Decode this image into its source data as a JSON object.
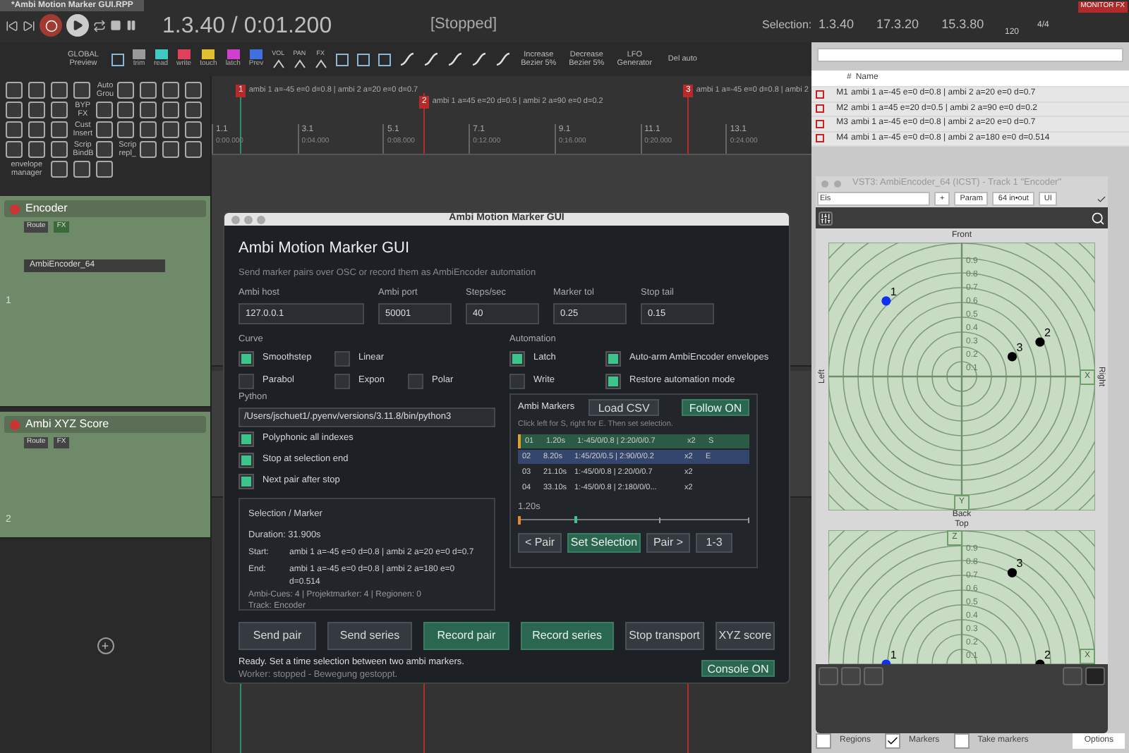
{
  "project_tab": "*Ambi Motion Marker GUI.RPP",
  "transport": {
    "position": "1.3.40 / 0:01.200",
    "state": "[Stopped]"
  },
  "selection": {
    "label": "Selection:",
    "start": "1.3.40",
    "end": "17.3.20",
    "length": "15.3.80"
  },
  "tempo": "120",
  "time_signature": "4/4",
  "monitor_fx": "MONITOR FX",
  "toolbar": [
    {
      "kind": "text",
      "label": "GLOBAL Preview"
    },
    {
      "kind": "icon"
    },
    {
      "kind": "mode",
      "label": "trim",
      "color": "#9a9a9a"
    },
    {
      "kind": "mode",
      "label": "read",
      "color": "#3fc9c0"
    },
    {
      "kind": "mode",
      "label": "write",
      "color": "#e0405a"
    },
    {
      "kind": "mode",
      "label": "touch",
      "color": "#e0c030"
    },
    {
      "kind": "mode",
      "label": "latch",
      "color": "#d040d0"
    },
    {
      "kind": "mode",
      "label": "Prev",
      "color": "#4070e0"
    },
    {
      "kind": "env",
      "label": "VOL"
    },
    {
      "kind": "env",
      "label": "PAN"
    },
    {
      "kind": "env",
      "label": "FX"
    },
    {
      "kind": "icon"
    },
    {
      "kind": "icon"
    },
    {
      "kind": "icon"
    },
    {
      "kind": "curve"
    },
    {
      "kind": "curve"
    },
    {
      "kind": "curve"
    },
    {
      "kind": "curve"
    },
    {
      "kind": "curve"
    },
    {
      "kind": "text",
      "label": "Increase Bezier 5%"
    },
    {
      "kind": "text",
      "label": "Decrease Bezier 5%"
    },
    {
      "kind": "text",
      "label": "LFO Generator"
    },
    {
      "kind": "text",
      "label": "Del auto"
    }
  ],
  "tool_grid": [
    {
      "kind": "icon"
    },
    {
      "kind": "icon"
    },
    {
      "kind": "icon"
    },
    {
      "kind": "icon"
    },
    {
      "kind": "text",
      "label": "Auto Grou"
    },
    {
      "kind": "icon"
    },
    {
      "kind": "icon"
    },
    {
      "kind": "icon"
    },
    {
      "kind": "icon"
    },
    {
      "kind": "icon"
    },
    {
      "kind": "icon"
    },
    {
      "kind": "icon"
    },
    {
      "kind": "text",
      "label": "BYP FX"
    },
    {
      "kind": "icon"
    },
    {
      "kind": "icon"
    },
    {
      "kind": "icon"
    },
    {
      "kind": "icon"
    },
    {
      "kind": "icon"
    },
    {
      "kind": "icon"
    },
    {
      "kind": "icon"
    },
    {
      "kind": "icon"
    },
    {
      "kind": "text",
      "label": "Cust Insert"
    },
    {
      "kind": "icon"
    },
    {
      "kind": "icon"
    },
    {
      "kind": "icon"
    },
    {
      "kind": "icon"
    },
    {
      "kind": "icon"
    },
    {
      "kind": "icon"
    },
    {
      "kind": "icon"
    },
    {
      "kind": "icon"
    },
    {
      "kind": "text",
      "label": "Scrip BindB"
    },
    {
      "kind": "icon"
    },
    {
      "kind": "text",
      "label": "Scrip repl_"
    },
    {
      "kind": "icon"
    },
    {
      "kind": "icon"
    },
    {
      "kind": "icon"
    },
    {
      "kind": "text",
      "label": "envelope manager"
    },
    {
      "kind": "icon"
    },
    {
      "kind": "icon"
    },
    {
      "kind": "icon"
    }
  ],
  "timeline_markers": [
    {
      "number": "1",
      "label": "ambi 1 a=-45 e=0 d=0.8 | ambi 2 a=20 e=0 d=0.7"
    },
    {
      "number": "2",
      "label": "ambi 1 a=45 e=20 d=0.5 | ambi 2 a=90 e=0 d=0.2"
    },
    {
      "number": "3",
      "label": "ambi 1 a=-45 e=0 d=0.8 | ambi 2"
    }
  ],
  "ruler": [
    {
      "bar": "1.1",
      "time": "0:00.000"
    },
    {
      "bar": "3.1",
      "time": "0:04.000"
    },
    {
      "bar": "5.1",
      "time": "0:08.000"
    },
    {
      "bar": "7.1",
      "time": "0:12.000"
    },
    {
      "bar": "9.1",
      "time": "0:16.000"
    },
    {
      "bar": "11.1",
      "time": "0:20.000"
    },
    {
      "bar": "13.1",
      "time": "0:24.000"
    }
  ],
  "tracks": [
    {
      "number": "1",
      "name": "Encoder",
      "route": "Route",
      "fx": "FX",
      "plugin": "AmbiEncoder_64"
    },
    {
      "number": "2",
      "name": "Ambi XYZ Score",
      "route": "Route",
      "fx": "FX"
    }
  ],
  "add_track": "+",
  "marker_list": {
    "columns": [
      "#",
      "Name"
    ],
    "rows": [
      {
        "id": "M1",
        "name": "ambi 1 a=-45 e=0 d=0.8 | ambi 2 a=20 e=0 d=0.7"
      },
      {
        "id": "M2",
        "name": "ambi 1 a=45 e=20 d=0.5 | ambi 2 a=90 e=0 d=0.2"
      },
      {
        "id": "M3",
        "name": "ambi 1 a=-45 e=0 d=0.8 | ambi 2 a=20 e=0 d=0.7"
      },
      {
        "id": "M4",
        "name": "ambi 1 a=-45 e=0 d=0.8 | ambi 2 a=180 e=0 d=0.514"
      }
    ],
    "options": [
      {
        "label": "Regions",
        "checked": false
      },
      {
        "label": "Markers",
        "checked": true
      },
      {
        "label": "Take markers",
        "checked": false
      }
    ],
    "options_button": "Options"
  },
  "plugin": {
    "title": "VST3: AmbiEncoder_64 (ICST) - Track 1 \"Encoder\"",
    "preset": "Eis",
    "buttons": [
      "+",
      "Param",
      "64 in•out",
      "UI"
    ],
    "top_pad": {
      "front": "Front",
      "back": "Back",
      "left": "Left",
      "right": "Right",
      "x_axis": "X",
      "y_axis": "Y",
      "rings": [
        "0.9",
        "0.8",
        "0.7",
        "0.6",
        "0.5",
        "0.4",
        "0.3",
        "0.2",
        "0.1"
      ],
      "points": [
        {
          "label": "1",
          "selected": true
        },
        {
          "label": "2",
          "selected": false
        },
        {
          "label": "3",
          "selected": false
        }
      ]
    },
    "side_pad": {
      "top": "Top",
      "z_axis": "Z",
      "x_axis": "X",
      "rings": [
        "0.9",
        "0.8",
        "0.7",
        "0.6",
        "0.5",
        "0.4",
        "0.3",
        "0.2",
        "0.1"
      ],
      "points": [
        {
          "label": "1",
          "selected": true
        },
        {
          "label": "2",
          "selected": false
        },
        {
          "label": "3",
          "selected": false
        }
      ]
    }
  },
  "dialog": {
    "window_title": "Ambi Motion Marker GUI",
    "heading": "Ambi Motion Marker GUI",
    "subtitle": "Send marker pairs over OSC or record them as AmbiEncoder automation",
    "fields": [
      {
        "label": "Ambi host",
        "value": "127.0.0.1"
      },
      {
        "label": "Ambi port",
        "value": "50001"
      },
      {
        "label": "Steps/sec",
        "value": "40"
      },
      {
        "label": "Marker tol",
        "value": "0.25"
      },
      {
        "label": "Stop tail",
        "value": "0.15"
      }
    ],
    "curve": {
      "label": "Curve",
      "options": [
        {
          "label": "Smoothstep",
          "checked": true
        },
        {
          "label": "Linear",
          "checked": false
        },
        {
          "label": "Parabol",
          "checked": false
        },
        {
          "label": "Expon",
          "checked": false
        },
        {
          "label": "Polar",
          "checked": false
        }
      ]
    },
    "automation": {
      "label": "Automation",
      "options": [
        {
          "label": "Latch",
          "checked": true
        },
        {
          "label": "Auto-arm AmbiEncoder envelopes",
          "checked": true
        },
        {
          "label": "Write",
          "checked": false
        },
        {
          "label": "Restore automation mode",
          "checked": true
        }
      ]
    },
    "python": {
      "label": "Python",
      "value": "/Users/jschuet1/.pyenv/versions/3.11.8/bin/python3"
    },
    "flags": [
      {
        "label": "Polyphonic all indexes",
        "checked": true
      },
      {
        "label": "Stop at selection end",
        "checked": true
      },
      {
        "label": "Next pair after stop",
        "checked": true
      }
    ],
    "selection_box": {
      "title": "Selection / Marker",
      "duration": "Duration: 31.900s",
      "start_label": "Start:",
      "start": "ambi 1 a=-45 e=0 d=0.8 | ambi 2 a=20 e=0 d=0.7",
      "end_label": "End:",
      "end": "ambi 1 a=-45 e=0 d=0.8 | ambi 2 a=180 e=0 d=0.514",
      "counts": "Ambi-Cues: 4 | Projektmarker: 4 | Regionen: 0",
      "track": "Track: Encoder"
    },
    "markers_panel": {
      "title": "Ambi Markers",
      "load": "Load CSV",
      "follow": "Follow ON",
      "hint": "Click left for S, right for E. Then set selection.",
      "rows": [
        {
          "index": "01",
          "time": "1.20s",
          "value": "1:-45/0/0.8 | 2:20/0/0.7",
          "count": "x2",
          "tag": "S",
          "kind": "start"
        },
        {
          "index": "02",
          "time": "8.20s",
          "value": "1:45/20/0.5 | 2:90/0/0.2",
          "count": "x2",
          "tag": "E",
          "kind": "end"
        },
        {
          "index": "03",
          "time": "21.10s",
          "value": "1:-45/0/0.8 | 2:20/0/0.7",
          "count": "x2",
          "kind": "plain"
        },
        {
          "index": "04",
          "time": "33.10s",
          "value": "1:-45/0/0.8 | 2:180/0/0...",
          "count": "x2",
          "kind": "plain"
        }
      ],
      "slider_reading": "1.20s",
      "level": 0.0,
      "buttons": [
        {
          "label": "< Pair",
          "primary": false
        },
        {
          "label": "Set Selection",
          "primary": true
        },
        {
          "label": "Pair >",
          "primary": false
        },
        {
          "label": "1-3",
          "primary": false
        }
      ]
    },
    "actions": [
      {
        "label": "Send pair",
        "primary": false
      },
      {
        "label": "Send series",
        "primary": false
      },
      {
        "label": "Record pair",
        "primary": true
      },
      {
        "label": "Record series",
        "primary": true
      },
      {
        "label": "Stop transport",
        "primary": false
      },
      {
        "label": "XYZ score",
        "primary": false
      }
    ],
    "status": "Ready. Set a time selection between two ambi markers.",
    "worker": "Worker: stopped - Bewegung gestoppt.",
    "console": "Console ON"
  }
}
